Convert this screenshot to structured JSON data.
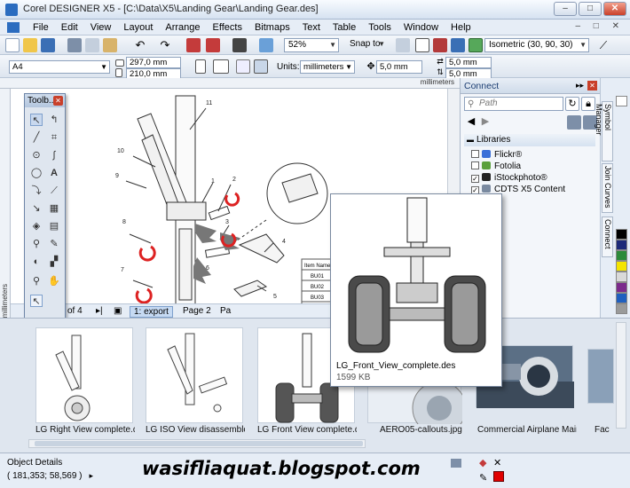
{
  "window": {
    "title": "Corel DESIGNER X5 - [C:\\Data\\X5\\Landing Gear\\Landing Gear.des]"
  },
  "menubar": {
    "items": [
      "File",
      "Edit",
      "View",
      "Layout",
      "Arrange",
      "Effects",
      "Bitmaps",
      "Text",
      "Table",
      "Tools",
      "Window",
      "Help"
    ]
  },
  "toolbar1": {
    "zoom": "52%",
    "snap_to": "Snap to",
    "view_mode": "Isometric (30, 90, 30)"
  },
  "toolbar2": {
    "page_size": "A4",
    "width": "297,0 mm",
    "height": "210,0 mm",
    "units_label": "Units:",
    "units": "millimeters",
    "nudge": "5,0 mm",
    "dup_x": "5,0 mm",
    "dup_y": "5,0 mm"
  },
  "rulers": {
    "unit": "millimeters"
  },
  "toolbox": {
    "title": "Toolb..."
  },
  "page_tabs": {
    "count": "of 4",
    "tabs": [
      "1: export",
      "Page 2",
      "Pa"
    ]
  },
  "right_panel": {
    "title": "Connect",
    "path_placeholder": "Path",
    "libraries_header": "Libraries",
    "libraries": [
      {
        "name": "Flickr®",
        "checked": false,
        "color": "#3a6fd8"
      },
      {
        "name": "Fotolia",
        "checked": false,
        "color": "#5aa03c"
      },
      {
        "name": "iStockphoto®",
        "checked": true,
        "color": "#222222"
      },
      {
        "name": "CDTS X5 Content",
        "checked": true,
        "color": "#7a8aa0"
      }
    ]
  },
  "docker_tabs": [
    "Symbol Manager",
    "Join Curves",
    "Connect"
  ],
  "palette": [
    "#ffffff",
    "#000000",
    "#1e2a78",
    "#2c8a3a",
    "#f4e400",
    "#d9d9d9",
    "#7b2a8c",
    "#1f5fbf",
    "#9a9a9a",
    "#5b2a86"
  ],
  "tray": {
    "items": [
      "LG Right View complete.d...",
      "LG ISO View disassemble...",
      "LG Front View complete.d...",
      "AERO05-callouts.jpg",
      "Commercial Airplane Main...",
      "Fac"
    ]
  },
  "popup": {
    "name": "LG_Front_View_complete.des",
    "size": "1599 KB"
  },
  "drawing": {
    "callouts": [
      "11",
      "10",
      "9",
      "8",
      "7",
      "6",
      "5",
      "4",
      "3",
      "2",
      "1"
    ],
    "table_header": "Item Name",
    "table_rows": [
      "BU01",
      "BU02",
      "BU03"
    ]
  },
  "statusbar": {
    "title": "Object Details",
    "coords": "( 181,353; 58,569 )"
  },
  "watermark": "wasifliaquat.blogspot.com"
}
